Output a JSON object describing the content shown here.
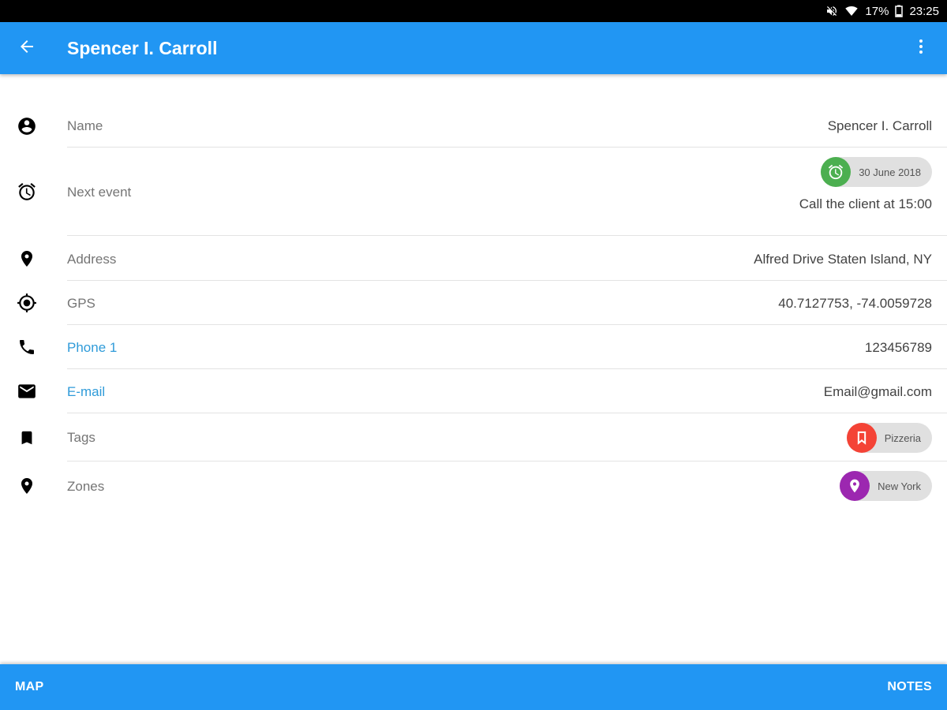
{
  "status_bar": {
    "battery": "17%",
    "time": "23:25",
    "icons": [
      "mute-icon",
      "wifi-icon",
      "battery-icon"
    ]
  },
  "app_bar": {
    "title": "Spencer I. Carroll",
    "color": "#2196f3",
    "icons": [
      "back-arrow-icon",
      "more-vert-icon"
    ]
  },
  "fields": {
    "name": {
      "label": "Name",
      "value": "Spencer I. Carroll",
      "icon": "account-circle-icon"
    },
    "next_event": {
      "label": "Next event",
      "date": "30 June 2018",
      "description": "Call the client at 15:00",
      "icon": "alarm-icon",
      "chip_color": "#4caf50"
    },
    "address": {
      "label": "Address",
      "value": "Alfred Drive Staten Island, NY",
      "icon": "location-pin-icon"
    },
    "gps": {
      "label": "GPS",
      "value": "40.7127753, -74.0059728",
      "icon": "gps-target-icon"
    },
    "phone": {
      "label": "Phone 1",
      "value": "123456789",
      "icon": "phone-icon"
    },
    "email": {
      "label": "E-mail",
      "value": "Email@gmail.com",
      "icon": "mail-icon"
    },
    "tags": {
      "label": "Tags",
      "chip": "Pizzeria",
      "icon": "bookmark-icon",
      "chip_color": "#f44336"
    },
    "zones": {
      "label": "Zones",
      "chip": "New York",
      "icon": "location-pin-icon",
      "chip_color": "#9c27b0"
    }
  },
  "bottom_bar": {
    "map_label": "MAP",
    "notes_label": "NOTES"
  }
}
